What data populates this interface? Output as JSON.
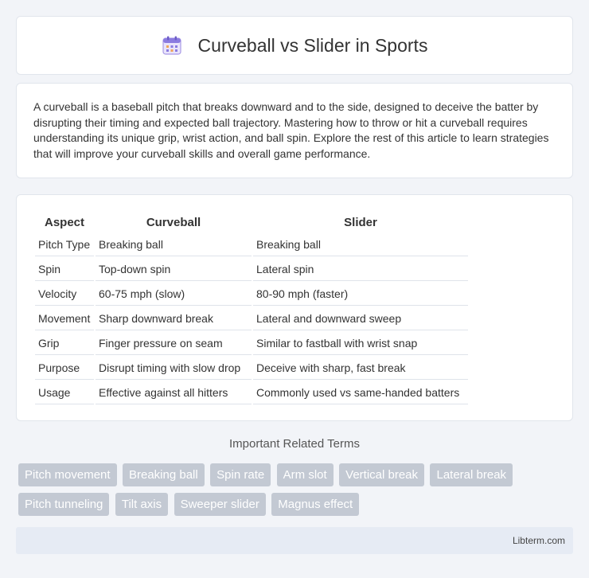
{
  "header": {
    "title": "Curveball vs Slider in Sports",
    "logo_icon": "calendar-icon"
  },
  "intro": {
    "text": "A curveball is a baseball pitch that breaks downward and to the side, designed to deceive the batter by disrupting their timing and expected ball trajectory. Mastering how to throw or hit a curveball requires understanding its unique grip, wrist action, and ball spin. Explore the rest of this article to learn strategies that will improve your curveball skills and overall game performance."
  },
  "table": {
    "headers": [
      "Aspect",
      "Curveball",
      "Slider"
    ],
    "rows": [
      [
        "Pitch Type",
        "Breaking ball",
        "Breaking ball"
      ],
      [
        "Spin",
        "Top-down spin",
        "Lateral spin"
      ],
      [
        "Velocity",
        "60-75 mph (slow)",
        "80-90 mph (faster)"
      ],
      [
        "Movement",
        "Sharp downward break",
        "Lateral and downward sweep"
      ],
      [
        "Grip",
        "Finger pressure on seam",
        "Similar to fastball with wrist snap"
      ],
      [
        "Purpose",
        "Disrupt timing with slow drop",
        "Deceive with sharp, fast break"
      ],
      [
        "Usage",
        "Effective against all hitters",
        "Commonly used vs same-handed batters"
      ]
    ]
  },
  "related": {
    "title": "Important Related Terms",
    "tags": [
      "Pitch movement",
      "Breaking ball",
      "Spin rate",
      "Arm slot",
      "Vertical break",
      "Lateral break",
      "Pitch tunneling",
      "Tilt axis",
      "Sweeper slider",
      "Magnus effect"
    ]
  },
  "footer": {
    "text": "Libterm.com"
  }
}
